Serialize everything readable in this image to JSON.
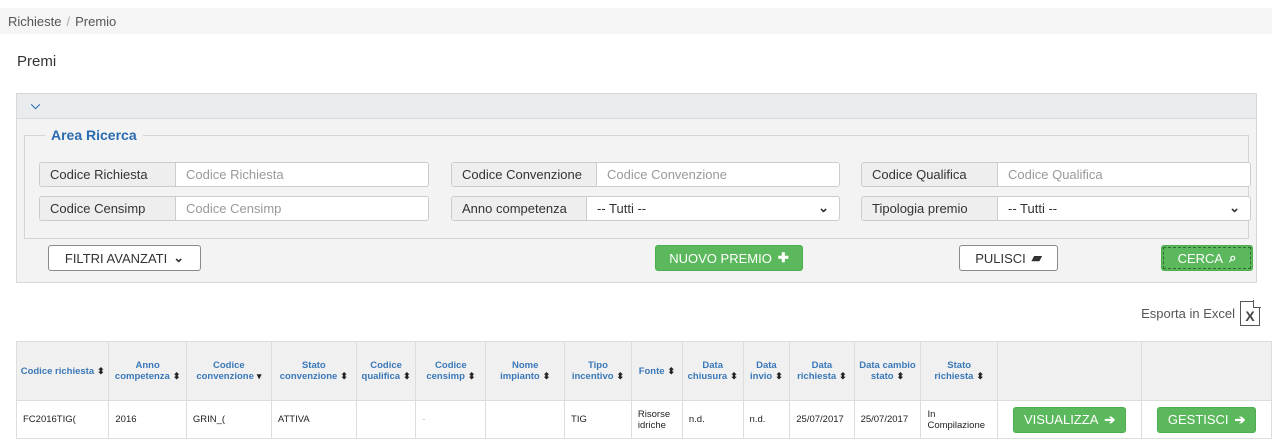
{
  "breadcrumb": {
    "items": [
      "Richieste",
      "Premio"
    ],
    "separator": "/"
  },
  "page_title": "Premi",
  "search": {
    "legend": "Area Ricerca",
    "codice_richiesta": {
      "label": "Codice Richiesta",
      "placeholder": "Codice Richiesta",
      "value": ""
    },
    "codice_convenzione": {
      "label": "Codice Convenzione",
      "placeholder": "Codice Convenzione",
      "value": ""
    },
    "codice_qualifica": {
      "label": "Codice Qualifica",
      "placeholder": "Codice Qualifica",
      "value": ""
    },
    "codice_censimp": {
      "label": "Codice Censimp",
      "placeholder": "Codice Censimp",
      "value": ""
    },
    "anno_competenza": {
      "label": "Anno competenza",
      "selected": "-- Tutti --"
    },
    "tipologia_premio": {
      "label": "Tipologia premio",
      "selected": "-- Tutti --"
    }
  },
  "buttons": {
    "filtri_avanzati": "FILTRI AVANZATI",
    "nuovo_premio": "NUOVO PREMIO",
    "pulisci": "PULISCI",
    "cerca": "CERCA"
  },
  "icons": {
    "collapse": "chevron-down-icon",
    "filtri": "chevron-down-icon",
    "nuovo": "plus-icon",
    "pulisci": "eraser-icon",
    "cerca": "search-icon",
    "excel": "excel-icon",
    "row_action": "arrow-right-icon"
  },
  "export": {
    "label": "Esporta in Excel",
    "icon_text": "X"
  },
  "table": {
    "headers": [
      "Codice richiesta",
      "Anno competenza",
      "Codice convenzione",
      "Stato convenzione",
      "Codice qualifica",
      "Codice censimp",
      "Nome impianto",
      "Tipo incentivo",
      "Fonte",
      "Data chiusura",
      "Data invio",
      "Data richiesta",
      "Data cambio stato",
      "Stato richiesta",
      "",
      ""
    ],
    "rows": [
      {
        "codice_richiesta": "FC2016TIG(",
        "anno": "2016",
        "codice_convenzione": "GRIN_(",
        "stato_convenzione": "ATTIVA",
        "codice_qualifica": "",
        "codice_censimp": "-",
        "nome_impianto": "",
        "tipo_incentivo": "TIG",
        "fonte": "Risorse idriche",
        "data_chiusura": "n.d.",
        "data_invio": "n.d.",
        "data_richiesta": "25/07/2017",
        "data_cambio_stato": "25/07/2017",
        "stato_richiesta": "In Compilazione",
        "visualizza": "VISUALIZZA",
        "gestisci": "GESTISCI"
      }
    ]
  },
  "colors": {
    "accent": "#2a6ab0",
    "success": "#5cb85c"
  }
}
